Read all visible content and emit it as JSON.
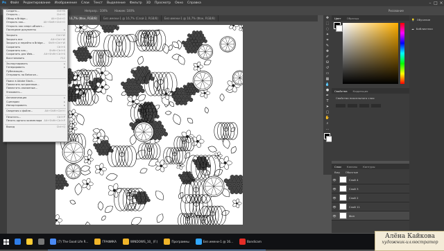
{
  "menubar": {
    "items": [
      "Файл",
      "Редактирование",
      "Изображение",
      "Слои",
      "Текст",
      "Выделение",
      "Фильтр",
      "3D",
      "Просмотр",
      "Окно",
      "Справка"
    ],
    "window_controls": [
      "–",
      "□",
      "×"
    ]
  },
  "options": {
    "opacity": "Непрозр.: 100%",
    "flow": "Нажим: 100%",
    "workspace": "Рисование"
  },
  "tabs": [
    {
      "label": "Без имени-1 @ 16,7% (Фон, RGB/8)",
      "active": true
    },
    {
      "label": "Без имени-1 @ 16,7% (Слой 2, RGB/8)",
      "active": false
    },
    {
      "label": "Без имени-1 @ 16,7% (Фон, RGB/8)",
      "active": false
    },
    {
      "label": "×",
      "active": false
    }
  ],
  "file_menu": {
    "items": [
      {
        "label": "Создать...",
        "shortcut": "Ctrl+N"
      },
      {
        "label": "Открыть...",
        "shortcut": "Ctrl+O"
      },
      {
        "label": "Обзор в Bridge...",
        "shortcut": "Alt+Ctrl+O"
      },
      {
        "label": "Открыть как...",
        "shortcut": "Alt+Shift+Ctrl+O"
      },
      {
        "label": "Открыть как смарт-объект...",
        "shortcut": ""
      },
      {
        "label": "Последние документы",
        "shortcut": "▸"
      },
      {
        "sep": true
      },
      {
        "label": "Закрыть",
        "shortcut": "Ctrl+W"
      },
      {
        "label": "Закрыть все",
        "shortcut": "Alt+Ctrl+W"
      },
      {
        "label": "Закрыть и перейти в Bridge...",
        "shortcut": "Shift+Ctrl+W"
      },
      {
        "label": "Сохранить",
        "shortcut": "Ctrl+S"
      },
      {
        "label": "Сохранить как...",
        "shortcut": "Shift+Ctrl+S"
      },
      {
        "label": "Сохранить для Web...",
        "shortcut": "Alt+Shift+Ctrl+S"
      },
      {
        "label": "Восстановить",
        "shortcut": "F12"
      },
      {
        "sep": true
      },
      {
        "label": "Экспортировать",
        "shortcut": "▸"
      },
      {
        "label": "Генерировать",
        "shortcut": "▸"
      },
      {
        "label": "Публикация...",
        "shortcut": ""
      },
      {
        "label": "Отправить на Behance...",
        "shortcut": ""
      },
      {
        "sep": true
      },
      {
        "label": "Поиск в Adobe Stock...",
        "shortcut": ""
      },
      {
        "label": "Поместить встроенные...",
        "shortcut": ""
      },
      {
        "label": "Поместить связанные...",
        "shortcut": ""
      },
      {
        "label": "Упаковать...",
        "shortcut": ""
      },
      {
        "sep": true
      },
      {
        "label": "Автоматизация",
        "shortcut": "▸"
      },
      {
        "label": "Сценарии",
        "shortcut": "▸"
      },
      {
        "label": "Импортировать",
        "shortcut": "▸"
      },
      {
        "sep": true
      },
      {
        "label": "Сведения о файле...",
        "shortcut": "Alt+Shift+Ctrl+I"
      },
      {
        "sep": true
      },
      {
        "label": "Печатать...",
        "shortcut": "Ctrl+P"
      },
      {
        "label": "Печать одного экземпляра",
        "shortcut": "Alt+Shift+Ctrl+P"
      },
      {
        "sep": true
      },
      {
        "label": "Выход",
        "shortcut": "Ctrl+Q"
      }
    ]
  },
  "panels": {
    "color": {
      "tabs": [
        "Цвет",
        "Образцы"
      ],
      "active_hue": "#ffb000"
    },
    "properties": {
      "tabs": [
        "Свойства",
        "Коррекция"
      ],
      "title": "Свойства пиксельного слоя"
    },
    "layers": {
      "tabs": [
        "Слои",
        "Каналы",
        "Контуры"
      ],
      "filter_label": "Вид",
      "mode": "Обычные",
      "layers": [
        "Слой 4",
        "Слой 3",
        "Слой 2",
        "Слой 11",
        "Фон"
      ]
    },
    "rightmost": {
      "items": [
        "Обучение",
        "Библиотеки"
      ]
    }
  },
  "taskbar": {
    "items": [
      {
        "label": "",
        "color": "#2e7de9"
      },
      {
        "label": "",
        "color": "#ffcc33"
      },
      {
        "label": "",
        "color": "#777777"
      },
      {
        "label": "(7) The Good Life R...",
        "color": "#4a8af4"
      },
      {
        "label": "ГРАФИКА",
        "color": "#f0b429"
      },
      {
        "label": "WINDOWS_10_ (F:)",
        "color": "#f0b429"
      },
      {
        "label": "Программы",
        "color": "#f0b429"
      },
      {
        "label": "Без имени-1 @ 16...",
        "color": "#31a8ff"
      },
      {
        "label": "Bandicam",
        "color": "#e52d27"
      }
    ],
    "clock": "13:36"
  },
  "watermark": {
    "line1": "Алёна Кайкова",
    "line2": "художник-иллюстратор"
  }
}
